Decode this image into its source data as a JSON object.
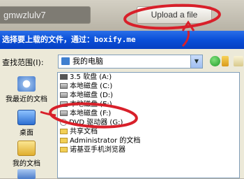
{
  "web": {
    "name_field_value": "gmwzlulv7",
    "upload_button_label": "Upload a file"
  },
  "dialog": {
    "title_prefix": "选择要上载的文件，通过：",
    "title_site": "boxify.me",
    "look_in_label": "查找范围(I):",
    "look_in_value": "我的电脑"
  },
  "places": [
    {
      "label": "我最近的文档"
    },
    {
      "label": "桌面"
    },
    {
      "label": "我的文档"
    }
  ],
  "items": [
    {
      "label": "3.5 软盘 (A:)",
      "icon": "floppy-icon"
    },
    {
      "label": "本地磁盘 (C:)",
      "icon": "drive-icon"
    },
    {
      "label": "本地磁盘 (D:)",
      "icon": "drive-icon"
    },
    {
      "label": "本地磁盘 (E:)",
      "icon": "drive-icon"
    },
    {
      "label": "本地磁盘 (F:)",
      "icon": "drive-icon"
    },
    {
      "label": "DVD 驱动器 (G:)",
      "icon": "dvd-icon"
    },
    {
      "label": "共享文档",
      "icon": "folder-icon"
    },
    {
      "label": "Administrator 的文档",
      "icon": "folder-icon"
    },
    {
      "label": "诺基亚手机浏览器",
      "icon": "folder-icon"
    }
  ],
  "annotation_color": "#d8202a"
}
